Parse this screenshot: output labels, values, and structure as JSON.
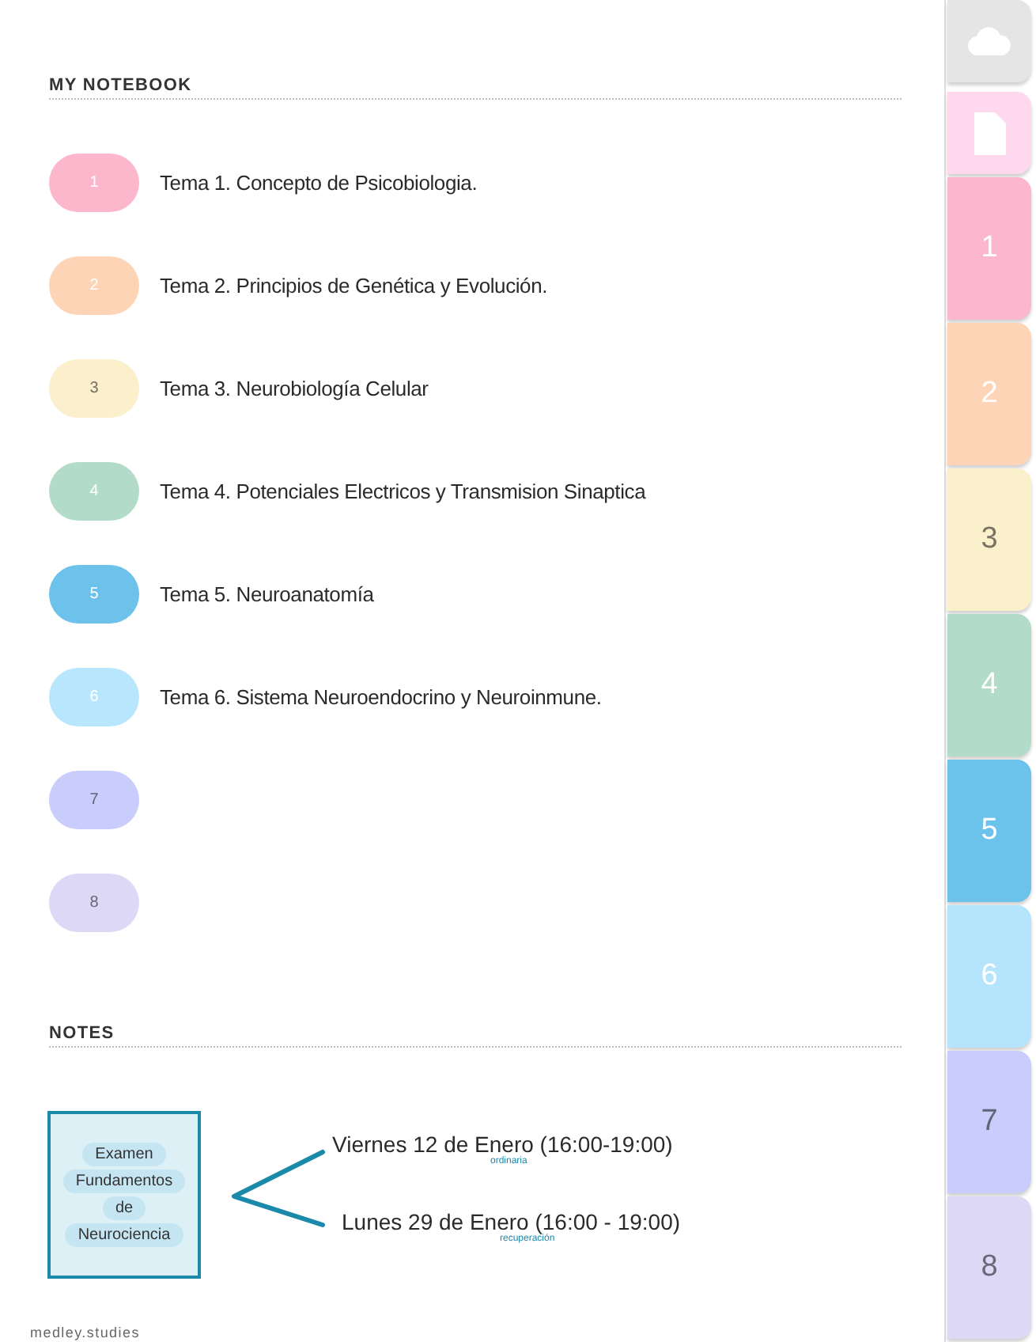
{
  "notebook": {
    "title": "MY NOTEBOOK",
    "topics": [
      {
        "number": "1",
        "title": "Tema 1. Concepto de Psicobiologia.",
        "color": "#fcb7cd"
      },
      {
        "number": "2",
        "title": "Tema 2. Principios de Genética y Evolución.",
        "color": "#fdd4b6"
      },
      {
        "number": "3",
        "title": "Tema 3. Neurobiología Celular",
        "color": "#fbf0cb"
      },
      {
        "number": "4",
        "title": "Tema 4. Potenciales Electricos y Transmision Sinaptica",
        "color": "#b2dcc9"
      },
      {
        "number": "5",
        "title": "Tema 5. Neuroanatomía",
        "color": "#6cc2ea"
      },
      {
        "number": "6",
        "title": "Tema 6. Sistema Neuroendocrino y Neuroinmune.",
        "color": "#b8e6fd"
      },
      {
        "number": "7",
        "color": "#c8cdfc"
      },
      {
        "number": "8",
        "color": "#ddd8f5"
      }
    ]
  },
  "notes": {
    "title": "NOTES",
    "card_lines": [
      "Examen",
      "Fundamentos",
      "de",
      "Neurociencia"
    ],
    "dates": [
      {
        "text": "Viernes 12 de Enero (16:00-19:00)",
        "annotation": "ordinaria"
      },
      {
        "text": "Lunes 29 de Enero (16:00 - 19:00)",
        "annotation": "recuperación"
      }
    ]
  },
  "footer": "medley.studies",
  "tabs": [
    {
      "kind": "cloud",
      "color": "#e5e5e5"
    },
    {
      "kind": "page",
      "color": "#fdd8ef"
    },
    {
      "kind": "number",
      "label": "1",
      "color": "#fcb6cd"
    },
    {
      "kind": "number",
      "label": "2",
      "color": "#fdd4b6"
    },
    {
      "kind": "number",
      "label": "3",
      "color": "#fbf0cc"
    },
    {
      "kind": "number",
      "label": "4",
      "color": "#b2dcc9"
    },
    {
      "kind": "number",
      "label": "5",
      "color": "#6bc2ea"
    },
    {
      "kind": "number",
      "label": "6",
      "color": "#b5e5fd"
    },
    {
      "kind": "number",
      "label": "7",
      "color": "#c8cdfc"
    },
    {
      "kind": "number",
      "label": "8",
      "color": "#dcd8f5"
    }
  ]
}
